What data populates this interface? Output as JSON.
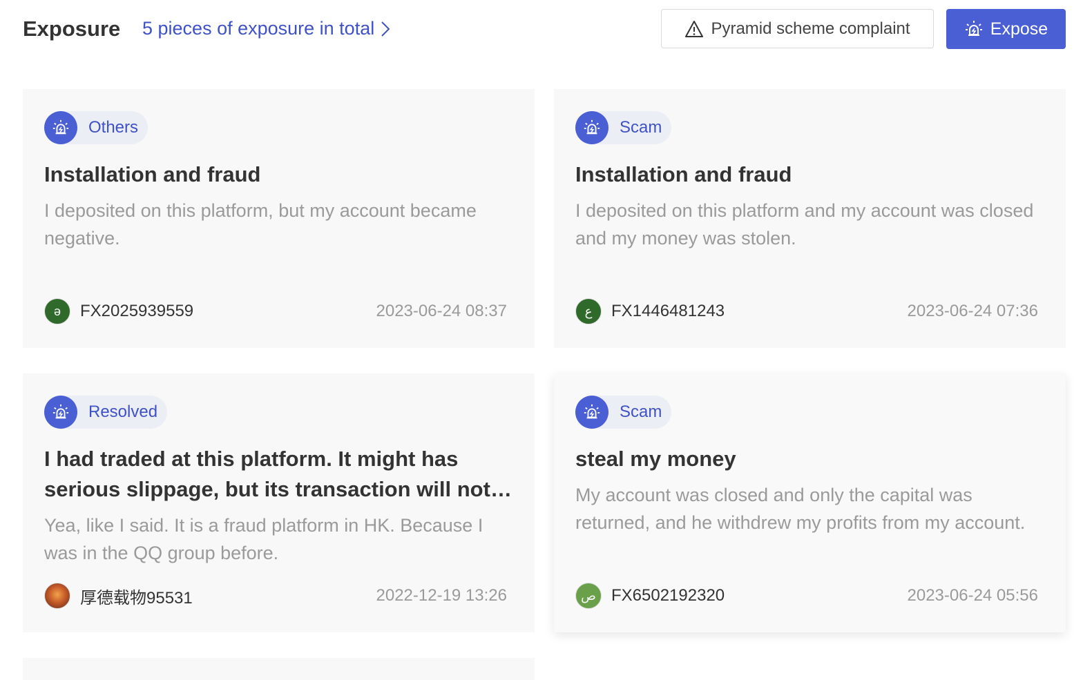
{
  "header": {
    "title": "Exposure",
    "total_link": "5 pieces of exposure in total",
    "complaint_button": "Pyramid scheme complaint",
    "expose_button": "Expose"
  },
  "colors": {
    "accent": "#4a5fd4",
    "tag_bg": "#eceef6",
    "card_bg": "#f8f8f9"
  },
  "cards": [
    {
      "tag": "Others",
      "title": "Installation and fraud",
      "description": "I deposited on this platform, but my account became negative.",
      "user": "FX2025939559",
      "avatar_glyph": "ә",
      "date": "2023-06-24 08:37"
    },
    {
      "tag": "Scam",
      "title": "Installation and fraud",
      "description": "I deposited on this platform and my account was closed and my money was stolen.",
      "user": "FX1446481243",
      "avatar_glyph": "ع",
      "date": "2023-06-24 07:36"
    },
    {
      "tag": "Resolved",
      "title": "I had traded at this platform. It might has serious slippage, but its transaction will not be executed.",
      "description": "Yea, like I said. It is a fraud platform in HK. Because I was in the QQ group before.",
      "user": "厚德载物95531",
      "avatar_glyph": "",
      "date": "2022-12-19 13:26"
    },
    {
      "tag": "Scam",
      "title": "steal my money",
      "description": "My account was closed and only the capital was returned, and he withdrew my profits from my account.",
      "user": "FX6502192320",
      "avatar_glyph": "ص",
      "date": "2023-06-24 05:56"
    }
  ]
}
